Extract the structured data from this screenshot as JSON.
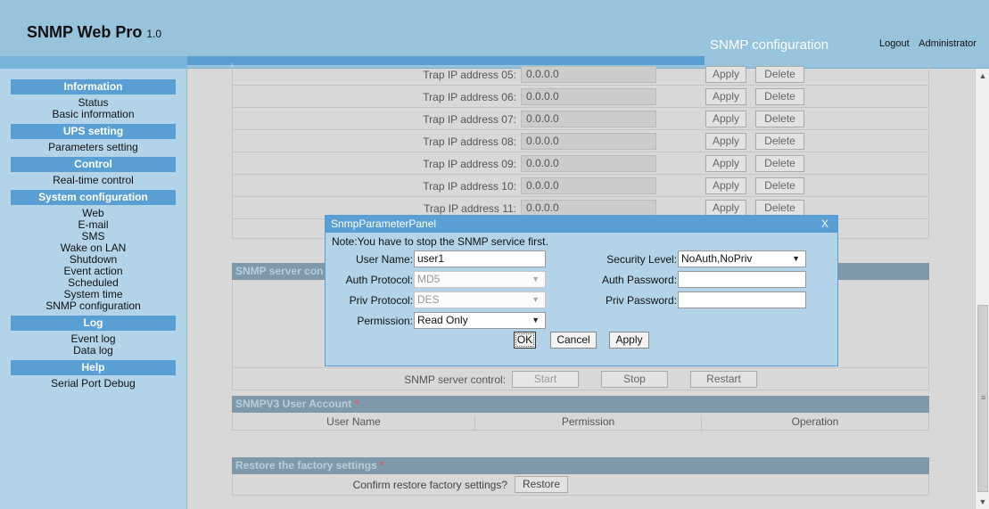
{
  "header": {
    "brand": "SNMP Web Pro",
    "version": "1.0",
    "page_title": "SNMP configuration",
    "logout": "Logout",
    "user": "Administrator"
  },
  "sidebar": {
    "groups": [
      {
        "title": "Information",
        "items": [
          "Status",
          "Basic information"
        ]
      },
      {
        "title": "UPS setting",
        "items": [
          "Parameters setting"
        ]
      },
      {
        "title": "Control",
        "items": [
          "Real-time control"
        ]
      },
      {
        "title": "System configuration",
        "items": [
          "Web",
          "E-mail",
          "SMS",
          "Wake on LAN",
          "Shutdown",
          "Event action",
          "Scheduled",
          "System time",
          "SNMP configuration"
        ]
      },
      {
        "title": "Log",
        "items": [
          "Event log",
          "Data log"
        ]
      },
      {
        "title": "Help",
        "items": [
          "Serial Port Debug"
        ]
      }
    ]
  },
  "traps": [
    {
      "label": "Trap IP address 05:",
      "value": "0.0.0.0"
    },
    {
      "label": "Trap IP address 06:",
      "value": "0.0.0.0"
    },
    {
      "label": "Trap IP address 07:",
      "value": "0.0.0.0"
    },
    {
      "label": "Trap IP address 08:",
      "value": "0.0.0.0"
    },
    {
      "label": "Trap IP address 09:",
      "value": "0.0.0.0"
    },
    {
      "label": "Trap IP address 10:",
      "value": "0.0.0.0"
    },
    {
      "label": "Trap IP address 11:",
      "value": "0.0.0.0"
    }
  ],
  "trap_buttons": {
    "apply": "Apply",
    "delete": "Delete"
  },
  "snmp_server": {
    "section_title_visible": "SNMP server con",
    "control_label": "SNMP server control:",
    "start": "Start",
    "stop": "Stop",
    "restart": "Restart"
  },
  "snmpv3": {
    "section_title": "SNMPV3 User Account",
    "req": "*",
    "columns": [
      "User Name",
      "Permission",
      "Operation"
    ]
  },
  "restore": {
    "section_title": "Restore the factory settings",
    "req": "*",
    "label": "Confirm restore factory settings?",
    "button": "Restore"
  },
  "dialog": {
    "title": "SnmpParameterPanel",
    "close": "X",
    "note": "Note:You have to stop the SNMP service first.",
    "user_name_label": "User Name:",
    "user_name_value": "user1",
    "security_level_label": "Security Level:",
    "security_level_value": "NoAuth,NoPriv",
    "auth_protocol_label": "Auth Protocol:",
    "auth_protocol_value": "MD5",
    "auth_password_label": "Auth Password:",
    "auth_password_value": "",
    "priv_protocol_label": "Priv Protocol:",
    "priv_protocol_value": "DES",
    "priv_password_label": "Priv Password:",
    "priv_password_value": "",
    "permission_label": "Permission:",
    "permission_value": "Read Only",
    "ok": "OK",
    "cancel": "Cancel",
    "apply": "Apply"
  },
  "colors": {
    "header_bg": "#97c3dc",
    "accent": "#5a9fd3",
    "sidebar_bg": "#b3d4e8"
  }
}
